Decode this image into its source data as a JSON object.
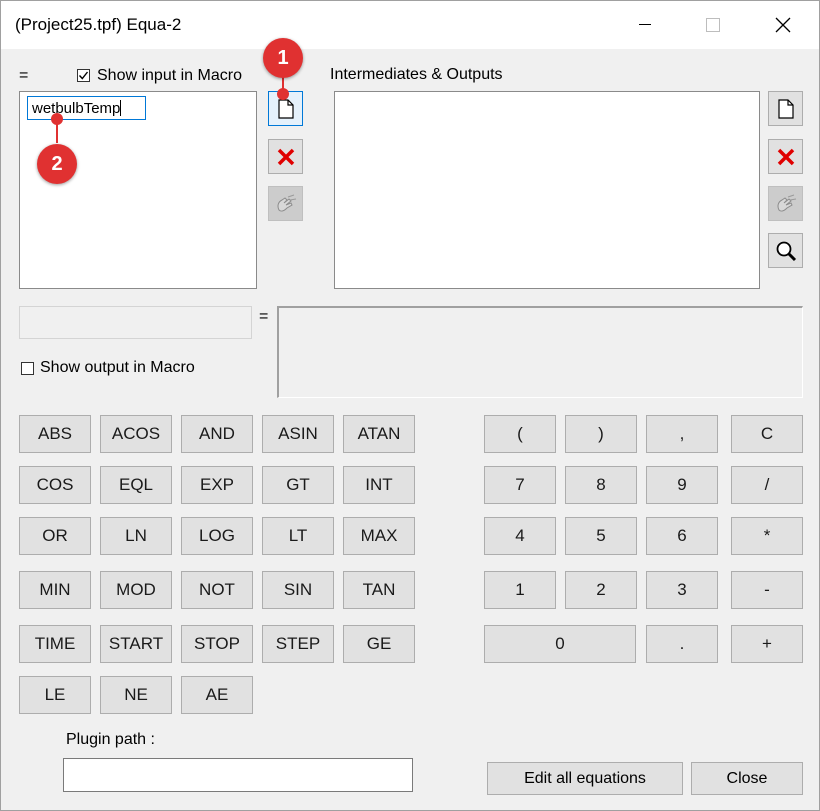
{
  "window": {
    "title": "(Project25.tpf) Equa-2"
  },
  "left_panel": {
    "equals_label": "=",
    "show_input_label": "Show input in Macro",
    "show_input_checked": true,
    "input_value": "wetbulbTemp"
  },
  "right_panel": {
    "intermediates_label": "Intermediates & Outputs"
  },
  "output": {
    "equals_label": "=",
    "show_output_label": "Show output in Macro",
    "show_output_checked": false
  },
  "func_keys": [
    "ABS",
    "ACOS",
    "AND",
    "ASIN",
    "ATAN",
    "COS",
    "EQL",
    "EXP",
    "GT",
    "INT",
    "OR",
    "LN",
    "LOG",
    "LT",
    "MAX",
    "MIN",
    "MOD",
    "NOT",
    "SIN",
    "TAN",
    "TIME",
    "START",
    "STOP",
    "STEP",
    "GE",
    "LE",
    "NE",
    "AE"
  ],
  "num_keys": [
    "(",
    ")",
    ",",
    "C",
    "7",
    "8",
    "9",
    "/",
    "4",
    "5",
    "6",
    "*",
    "1",
    "2",
    "3",
    "-",
    "0",
    ".",
    "+"
  ],
  "plugin": {
    "label": "Plugin path :",
    "value": ""
  },
  "buttons": {
    "edit_all": "Edit all equations",
    "close": "Close"
  },
  "annotations": [
    "1",
    "2"
  ],
  "icons": [
    "new-doc-icon",
    "delete-x-icon",
    "edit-hand-icon",
    "magnifier-icon",
    "minimize-icon",
    "maximize-icon",
    "close-icon",
    "checkmark-icon"
  ],
  "colors": {
    "annotation_red": "#e03131",
    "delete_red": "#e00000",
    "focus_blue": "#0078d7"
  }
}
